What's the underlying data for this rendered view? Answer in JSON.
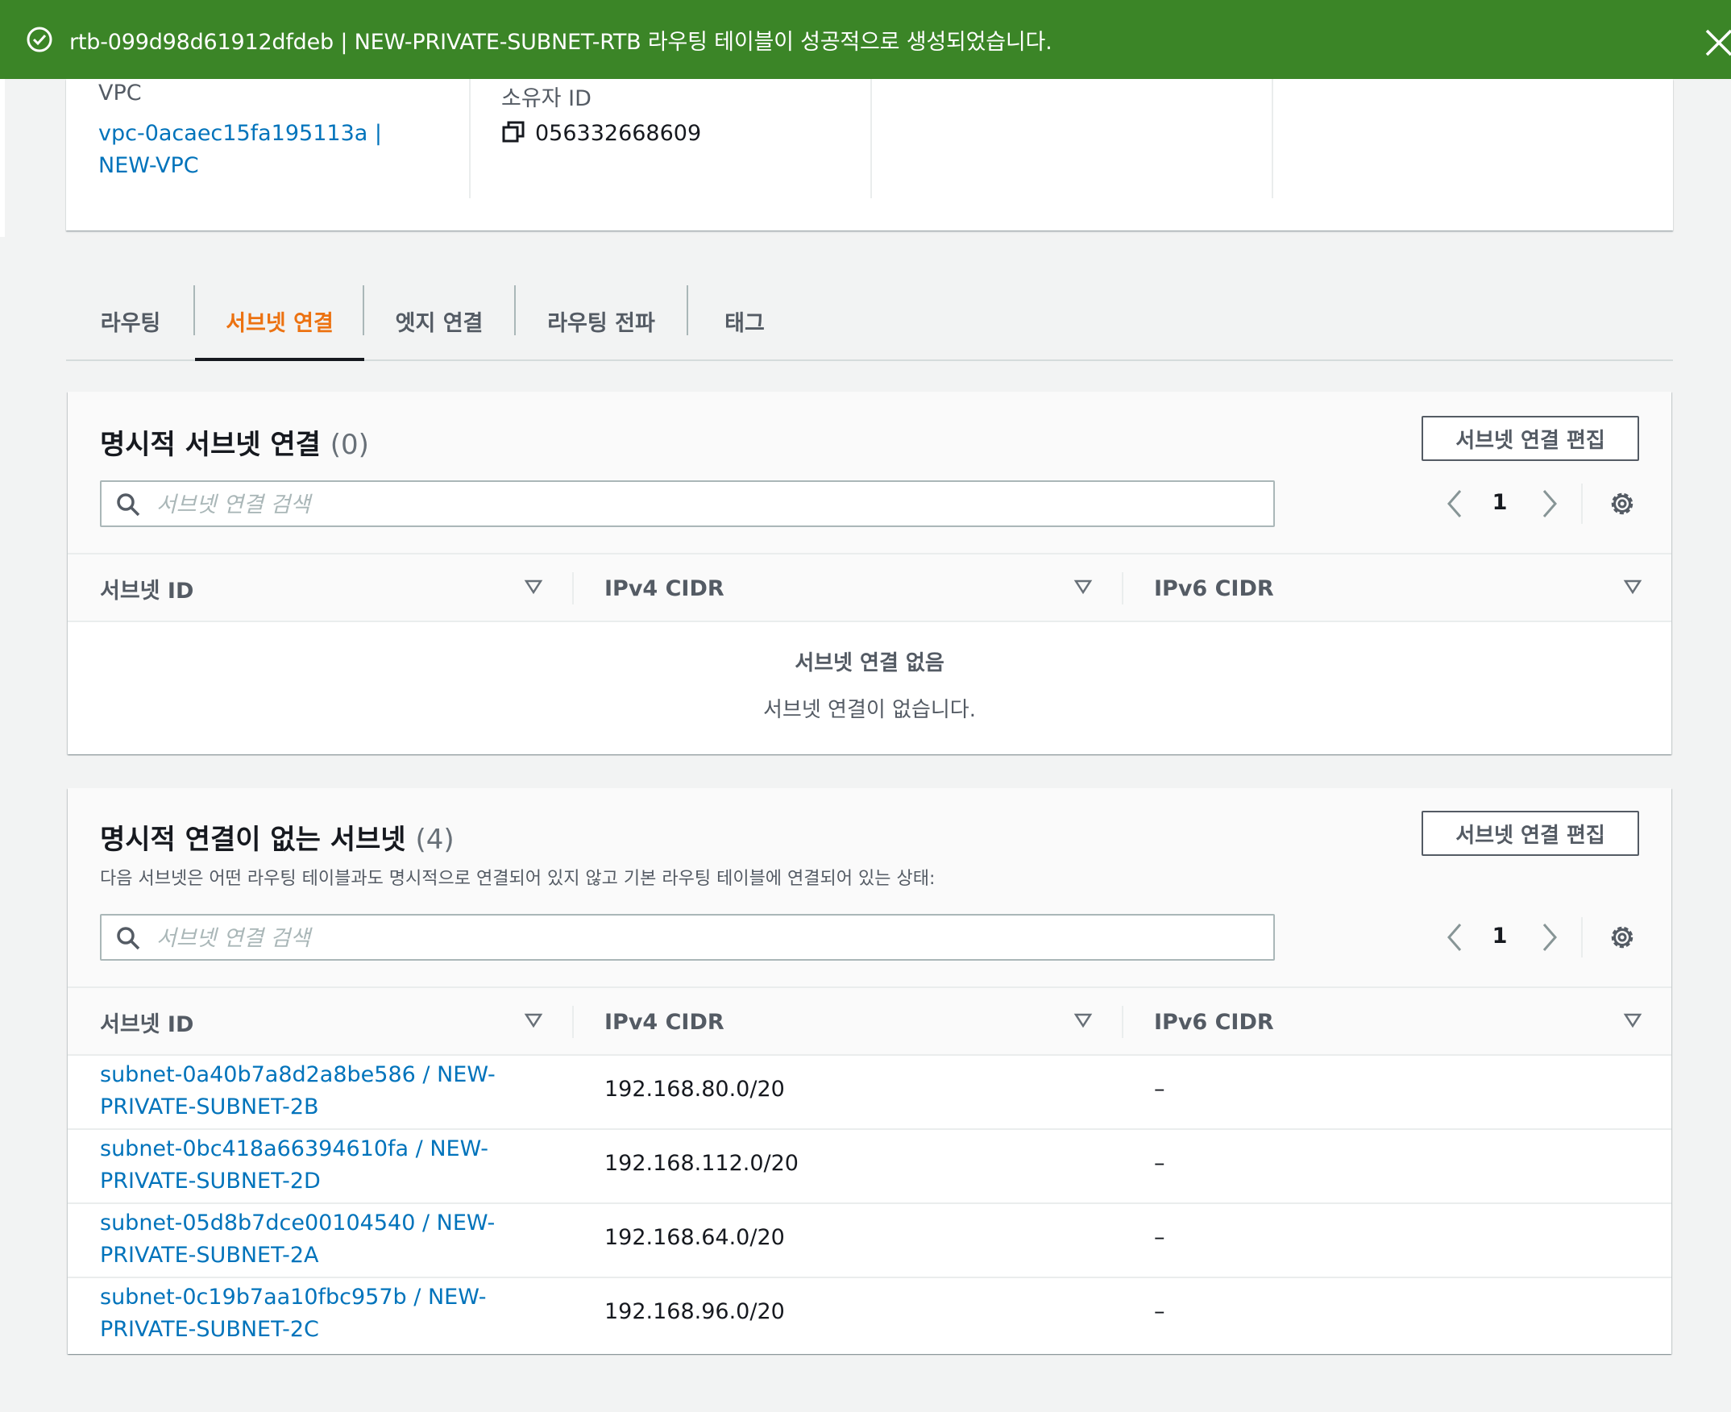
{
  "flash": {
    "message": "rtb-099d98d61912dfdeb | NEW-PRIVATE-SUBNET-RTB 라우팅 테이블이 성공적으로 생성되었습니다.",
    "color": "#3b8527"
  },
  "details": {
    "vpc_label": "VPC",
    "vpc_value": "vpc-0acaec15fa195113a | NEW-VPC",
    "owner_label": "소유자 ID",
    "owner_value": "056332668609"
  },
  "tabs": [
    {
      "label": "라우팅"
    },
    {
      "label": "서브넷 연결",
      "active": true
    },
    {
      "label": "엣지 연결"
    },
    {
      "label": "라우팅 전파"
    },
    {
      "label": "태그"
    }
  ],
  "explicit": {
    "title": "명시적 서브넷 연결",
    "count": "(0)",
    "edit_button": "서브넷 연결 편집",
    "search_placeholder": "서브넷 연결 검색",
    "page": "1",
    "columns": [
      "서브넷 ID",
      "IPv4 CIDR",
      "IPv6 CIDR"
    ],
    "empty_title": "서브넷 연결 없음",
    "empty_desc": "서브넷 연결이 없습니다."
  },
  "implicit": {
    "title": "명시적 연결이 없는 서브넷",
    "count": "(4)",
    "description": "다음 서브넷은 어떤 라우팅 테이블과도 명시적으로 연결되어 있지 않고 기본 라우팅 테이블에 연결되어 있는 상태:",
    "edit_button": "서브넷 연결 편집",
    "search_placeholder": "서브넷 연결 검색",
    "page": "1",
    "columns": [
      "서브넷 ID",
      "IPv4 CIDR",
      "IPv6 CIDR"
    ],
    "rows": [
      {
        "id": "subnet-0a40b7a8d2a8be586 / NEW-PRIVATE-SUBNET-2B",
        "ipv4": "192.168.80.0/20",
        "ipv6": "–"
      },
      {
        "id": "subnet-0bc418a66394610fa / NEW-PRIVATE-SUBNET-2D",
        "ipv4": "192.168.112.0/20",
        "ipv6": "–"
      },
      {
        "id": "subnet-05d8b7dce00104540 / NEW-PRIVATE-SUBNET-2A",
        "ipv4": "192.168.64.0/20",
        "ipv6": "–"
      },
      {
        "id": "subnet-0c19b7aa10fbc957b / NEW-PRIVATE-SUBNET-2C",
        "ipv4": "192.168.96.0/20",
        "ipv6": "–"
      }
    ]
  },
  "colors": {
    "link": "#0073bb",
    "active_tab": "#ec7211",
    "success": "#3b8527"
  }
}
